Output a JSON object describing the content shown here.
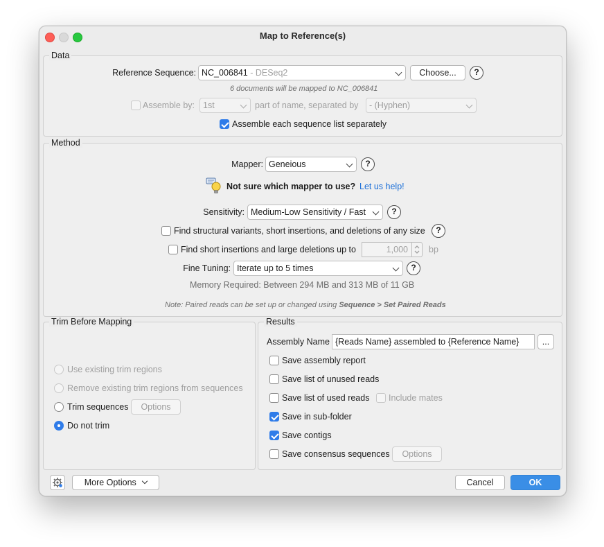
{
  "window": {
    "title": "Map to Reference(s)"
  },
  "data_section": {
    "legend": "Data",
    "reference_label": "Reference Sequence:",
    "reference_value": "NC_006841",
    "reference_suffix": " - DESeq2",
    "choose_button": "Choose...",
    "mapping_note": "6 documents will be mapped to NC_006841",
    "assemble_by_label": "Assemble by:",
    "assemble_by_value": "1st",
    "part_of_name_label": "part of name, separated by",
    "separator_value": "- (Hyphen)",
    "assemble_each_label": "Assemble each sequence list separately"
  },
  "method_section": {
    "legend": "Method",
    "mapper_label": "Mapper:",
    "mapper_value": "Geneious",
    "not_sure_text": "Not sure which mapper to use?",
    "help_link": "Let us help!",
    "sensitivity_label": "Sensitivity:",
    "sensitivity_value": "Medium-Low Sensitivity / Fast",
    "structural_label": "Find structural variants, short insertions, and deletions of any size",
    "short_insertions_label": "Find short insertions and large deletions up to",
    "short_insertions_value": "1,000",
    "bp_unit": "bp",
    "fine_tuning_label": "Fine Tuning:",
    "fine_tuning_value": "Iterate up to 5 times",
    "memory_text": "Memory Required: Between 294 MB and 313 MB of 11 GB",
    "note_prefix": "Note: Paired reads can be set up or changed using ",
    "note_bold": "Sequence > Set Paired Reads"
  },
  "trim_section": {
    "legend": "Trim Before Mapping",
    "use_existing": "Use existing trim regions",
    "remove_existing": "Remove existing trim regions from sequences",
    "trim_sequences": "Trim sequences",
    "options_button": "Options",
    "do_not_trim": "Do not trim"
  },
  "results_section": {
    "legend": "Results",
    "assembly_name_label": "Assembly Name",
    "assembly_name_value": "{Reads Name} assembled to {Reference Name}",
    "ellipsis_button": "...",
    "save_report": "Save assembly report",
    "save_unused": "Save list of unused reads",
    "save_used": "Save list of used reads",
    "include_mates": "Include mates",
    "save_subfolder": "Save in sub-folder",
    "save_contigs": "Save contigs",
    "save_consensus": "Save consensus sequences",
    "options_button": "Options"
  },
  "footer": {
    "more_options": "More Options",
    "cancel": "Cancel",
    "ok": "OK"
  },
  "colors": {
    "accent": "#2f7ce9",
    "ok_button": "#3a8ee6",
    "link": "#1a6ed8"
  }
}
